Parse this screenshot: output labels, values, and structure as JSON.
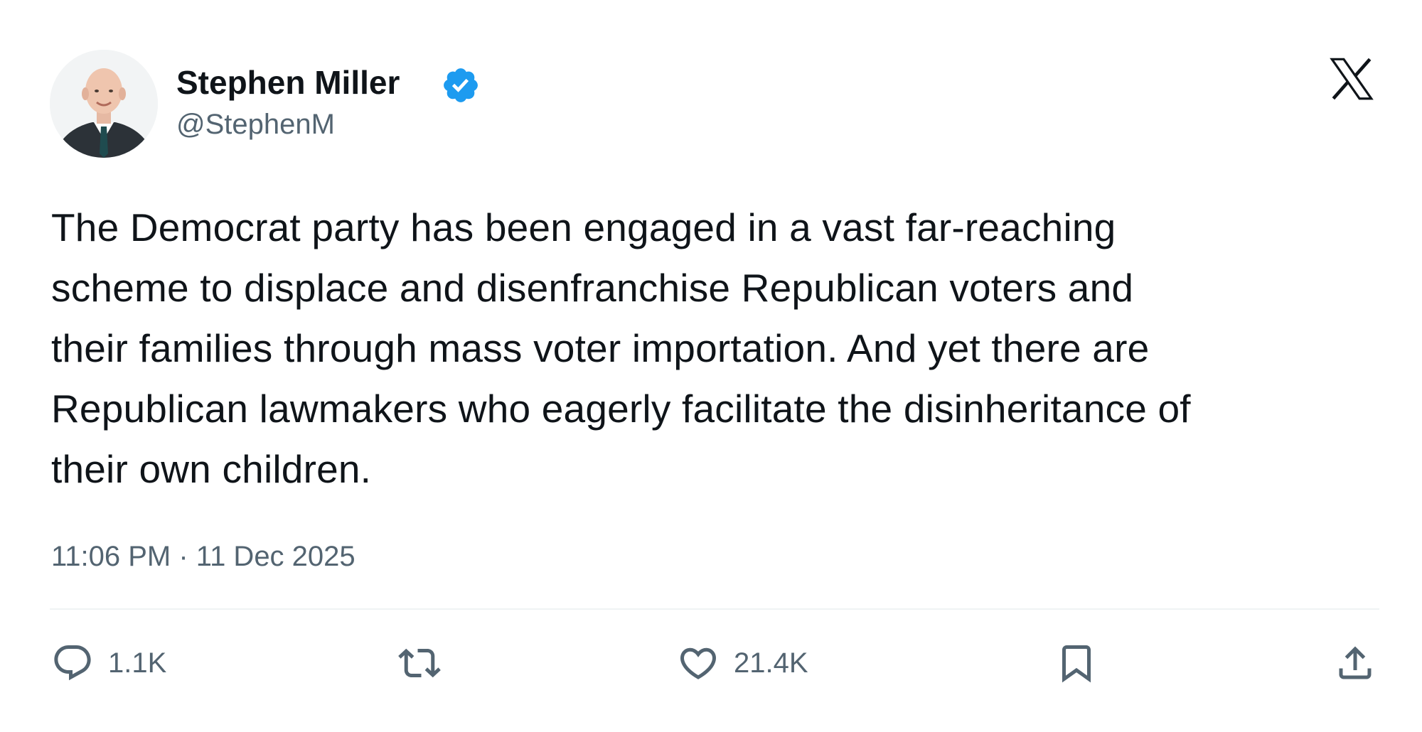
{
  "author": {
    "name": "Stephen Miller",
    "handle": "@StephenM",
    "verified": true
  },
  "tweet": {
    "lines": [
      "The Democrat party has been engaged in a vast far-reaching",
      "scheme to displace and disenfranchise Republican voters and",
      "their families through mass voter importation. And yet there are",
      "Republican lawmakers who eagerly facilitate the disinheritance of",
      "their own children."
    ],
    "timestamp": "11:06 PM · 11 Dec 2025"
  },
  "actions": {
    "reply": {
      "icon": "reply-icon",
      "count": "1.1K"
    },
    "repost": {
      "icon": "repost-icon",
      "count": ""
    },
    "like": {
      "icon": "heart-icon",
      "count": "21.4K"
    },
    "bookmark": {
      "icon": "bookmark-icon"
    },
    "share": {
      "icon": "share-icon"
    }
  },
  "colors": {
    "text": "#0f1419",
    "secondary": "#536471",
    "verified": "#1d9bf0",
    "divider": "#eff3f4"
  }
}
